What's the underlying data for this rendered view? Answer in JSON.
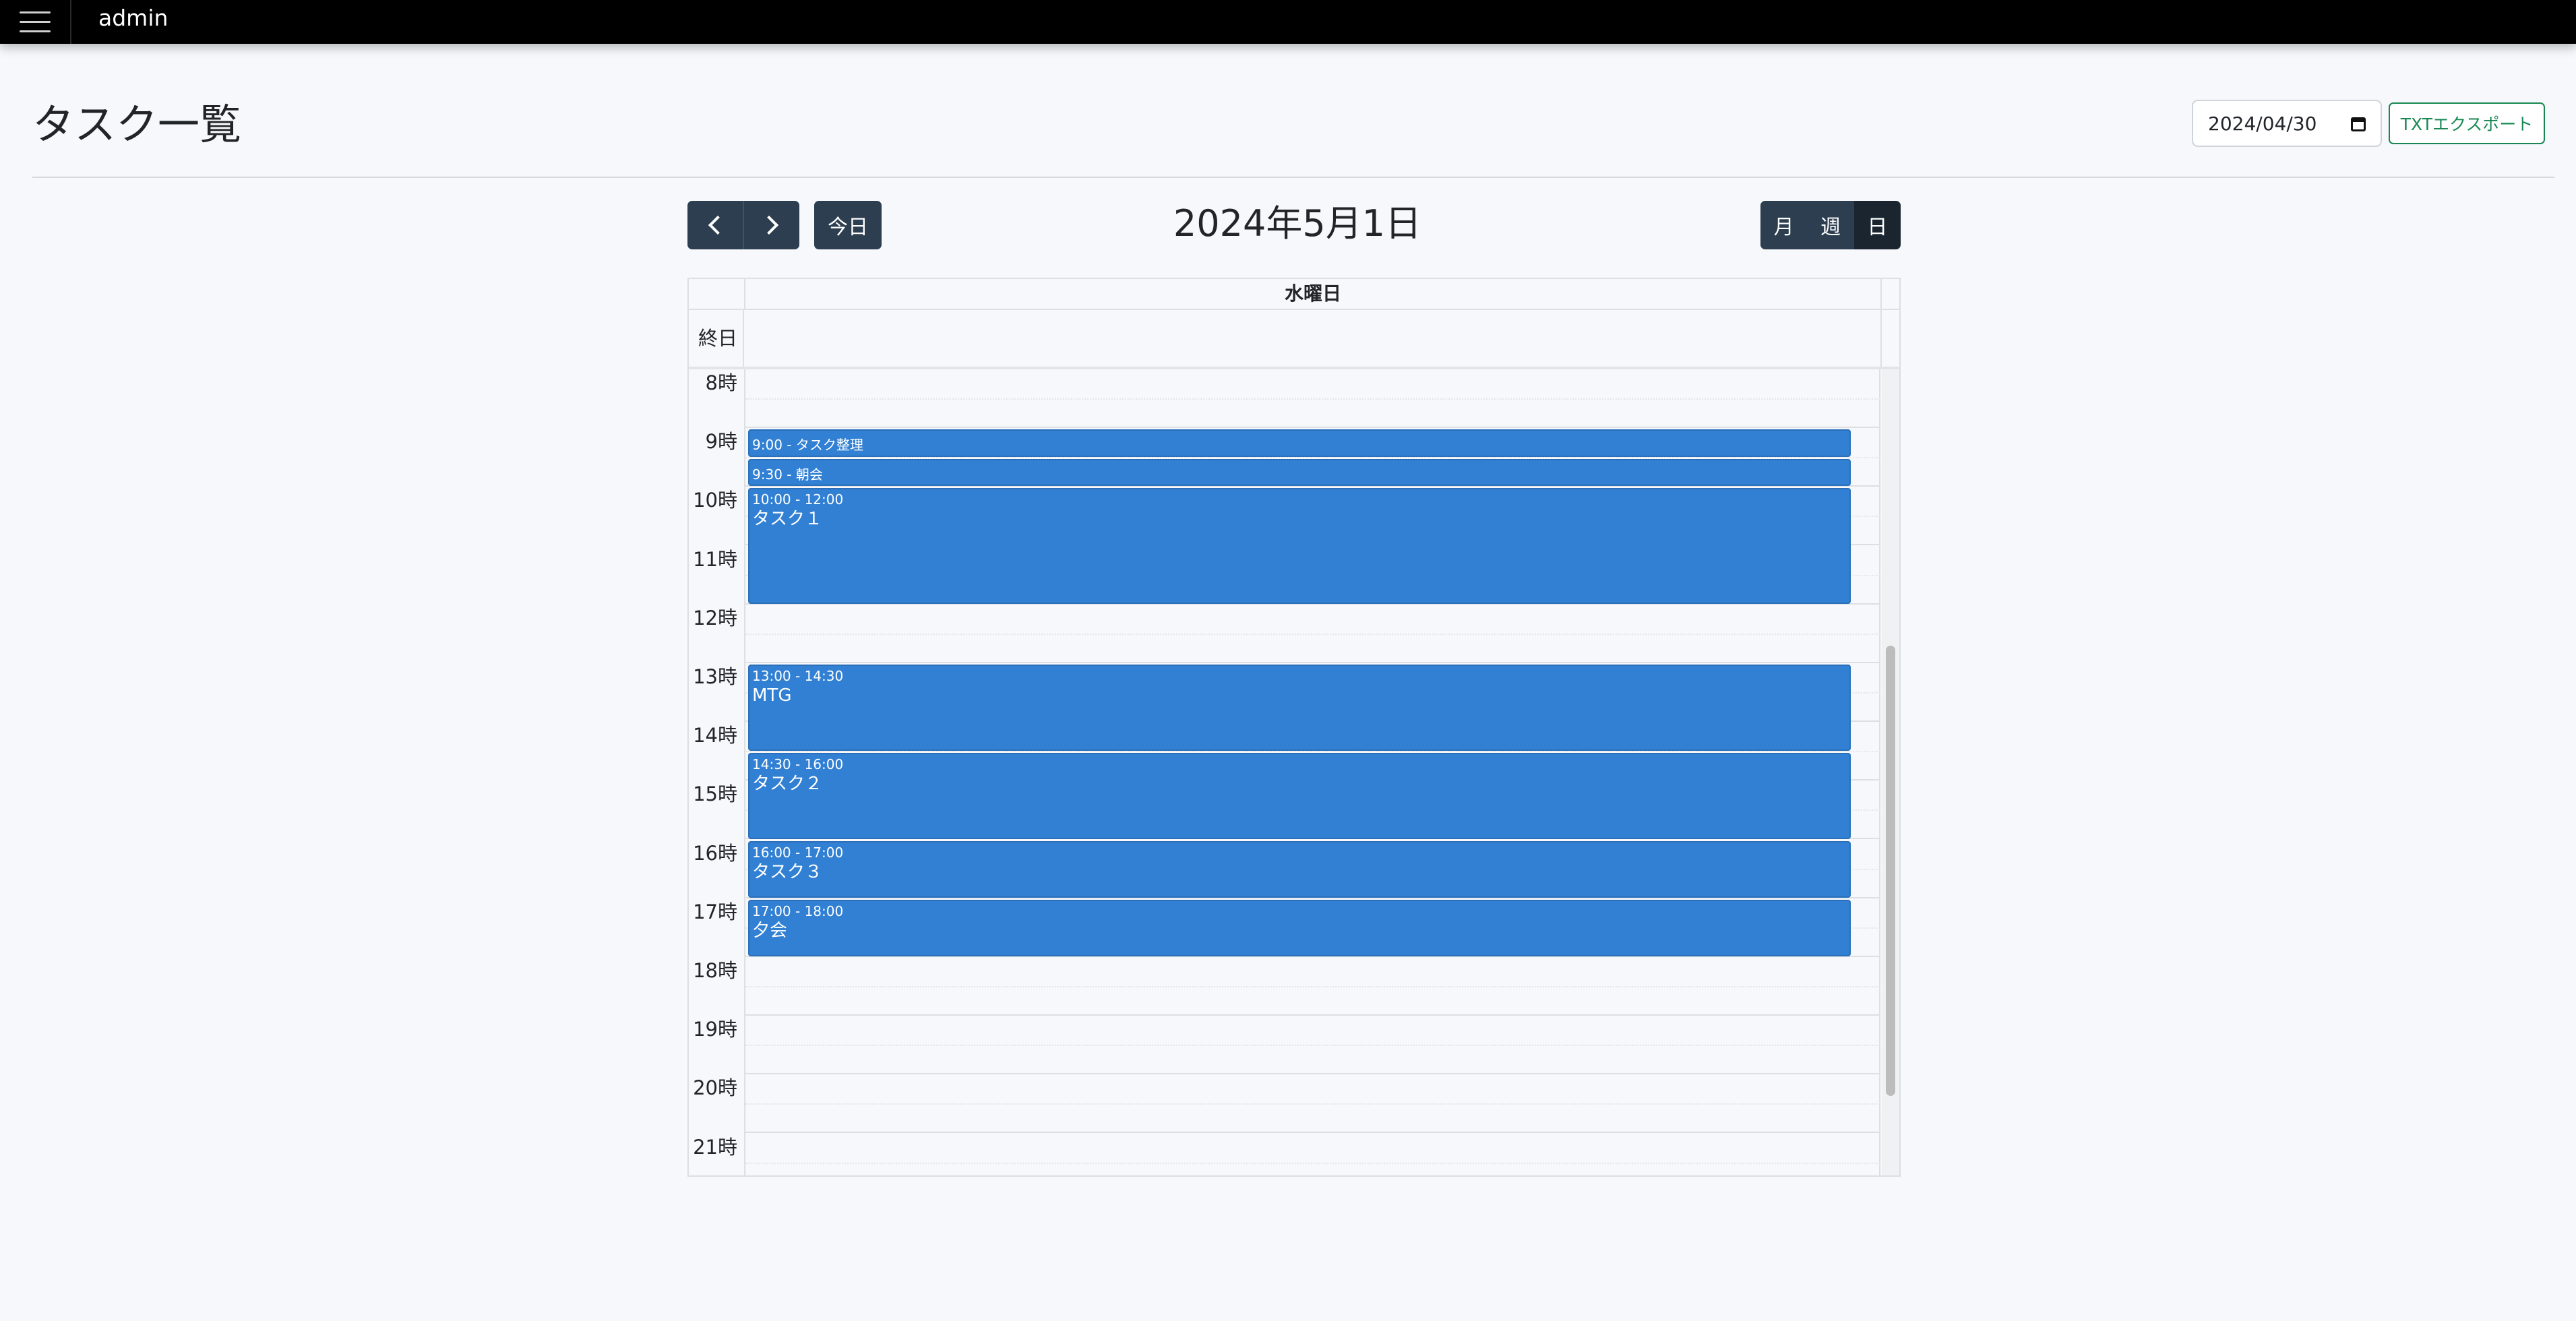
{
  "navbar": {
    "app_title": "admin"
  },
  "page": {
    "title": "タスク一覧"
  },
  "toolbar": {
    "date_value": "2024/04/30",
    "export_label": "TXTエクスポート"
  },
  "calendar": {
    "today_label": "今日",
    "title": "2024年5月1日",
    "views": [
      "月",
      "週",
      "日"
    ],
    "active_view": "日",
    "day_header": "水曜日",
    "allday_label": "終日",
    "hours": [
      "8時",
      "9時",
      "10時",
      "11時",
      "12時",
      "13時",
      "14時",
      "15時",
      "16時",
      "17時",
      "18時",
      "19時",
      "20時",
      "21時"
    ],
    "events": [
      {
        "time": "9:00 -",
        "title": "タスク整理",
        "start": "9:00",
        "end": "9:30"
      },
      {
        "time": "9:30 -",
        "title": "朝会",
        "start": "9:30",
        "end": "10:00"
      },
      {
        "time": "10:00 - 12:00",
        "title": "タスク１",
        "start": "10:00",
        "end": "12:00"
      },
      {
        "time": "13:00 - 14:30",
        "title": "MTG",
        "start": "13:00",
        "end": "14:30"
      },
      {
        "time": "14:30 - 16:00",
        "title": "タスク２",
        "start": "14:30",
        "end": "16:00"
      },
      {
        "time": "16:00 - 17:00",
        "title": "タスク３",
        "start": "16:00",
        "end": "17:00"
      },
      {
        "time": "17:00 - 18:00",
        "title": "夕会",
        "start": "17:00",
        "end": "18:00"
      }
    ]
  },
  "colors": {
    "event": "#3180d4",
    "navbar": "#000000",
    "dark_button": "#2c3e50",
    "export_accent": "#198754"
  }
}
